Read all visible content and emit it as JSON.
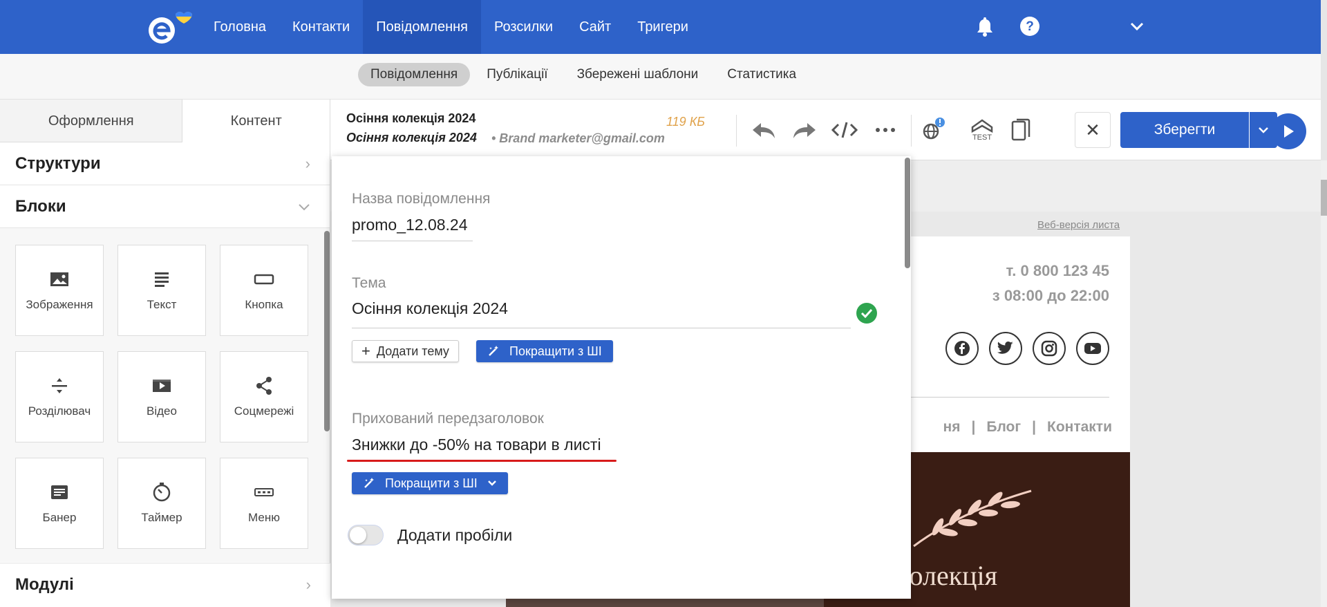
{
  "app": {
    "nav": [
      "Головна",
      "Контакти",
      "Повідомлення",
      "Розсилки",
      "Сайт",
      "Тригери"
    ],
    "nav_active": "Повідомлення",
    "subnav": [
      "Повідомлення",
      "Публікації",
      "Збережені шаблони",
      "Статистика"
    ],
    "accent": "#2e62c9"
  },
  "left": {
    "tab_design": "Оформлення",
    "tab_content": "Контент",
    "structures": "Структури",
    "blocks": "Блоки",
    "modules": "Модулі",
    "block_items": [
      {
        "label": "Зображення",
        "icon": "image-icon"
      },
      {
        "label": "Текст",
        "icon": "text-icon"
      },
      {
        "label": "Кнопка",
        "icon": "button-icon"
      },
      {
        "label": "Розділювач",
        "icon": "divider-icon"
      },
      {
        "label": "Відео",
        "icon": "video-icon"
      },
      {
        "label": "Соцмережі",
        "icon": "share-icon"
      },
      {
        "label": "Банер",
        "icon": "banner-icon"
      },
      {
        "label": "Таймер",
        "icon": "timer-icon"
      },
      {
        "label": "Меню",
        "icon": "menu-icon"
      }
    ]
  },
  "toolbar": {
    "title": "Осіння колекція 2024",
    "subject": "Осіння колекція 2024",
    "sender": "• Brand marketer@gmail.com",
    "size": "119 КБ",
    "test_label": "TEST",
    "save": "Зберегти"
  },
  "modal": {
    "name_label": "Назва повідомлення",
    "name_value": "promo_12.08.24",
    "subject_label": "Тема",
    "subject_value": "Осіння колекція 2024",
    "add_subject": "Додати тему",
    "improve_ai": "Покращити з ШІ",
    "preheader_label": "Прихований передзаголовок",
    "preheader_value": "Знижки до -50% на товари в листі",
    "improve_ai_2": "Покращити з ШІ",
    "spaces_label": "Додати пробіли",
    "spaces_on": false
  },
  "email": {
    "web_version": "Веб-версія листа",
    "phone": "т. 0 800 123 45",
    "hours": "з 08:00 до 22:00",
    "menu": [
      "ня",
      "|",
      "Блог",
      "|",
      "Контакти"
    ],
    "banner_text": "ова колекція"
  }
}
